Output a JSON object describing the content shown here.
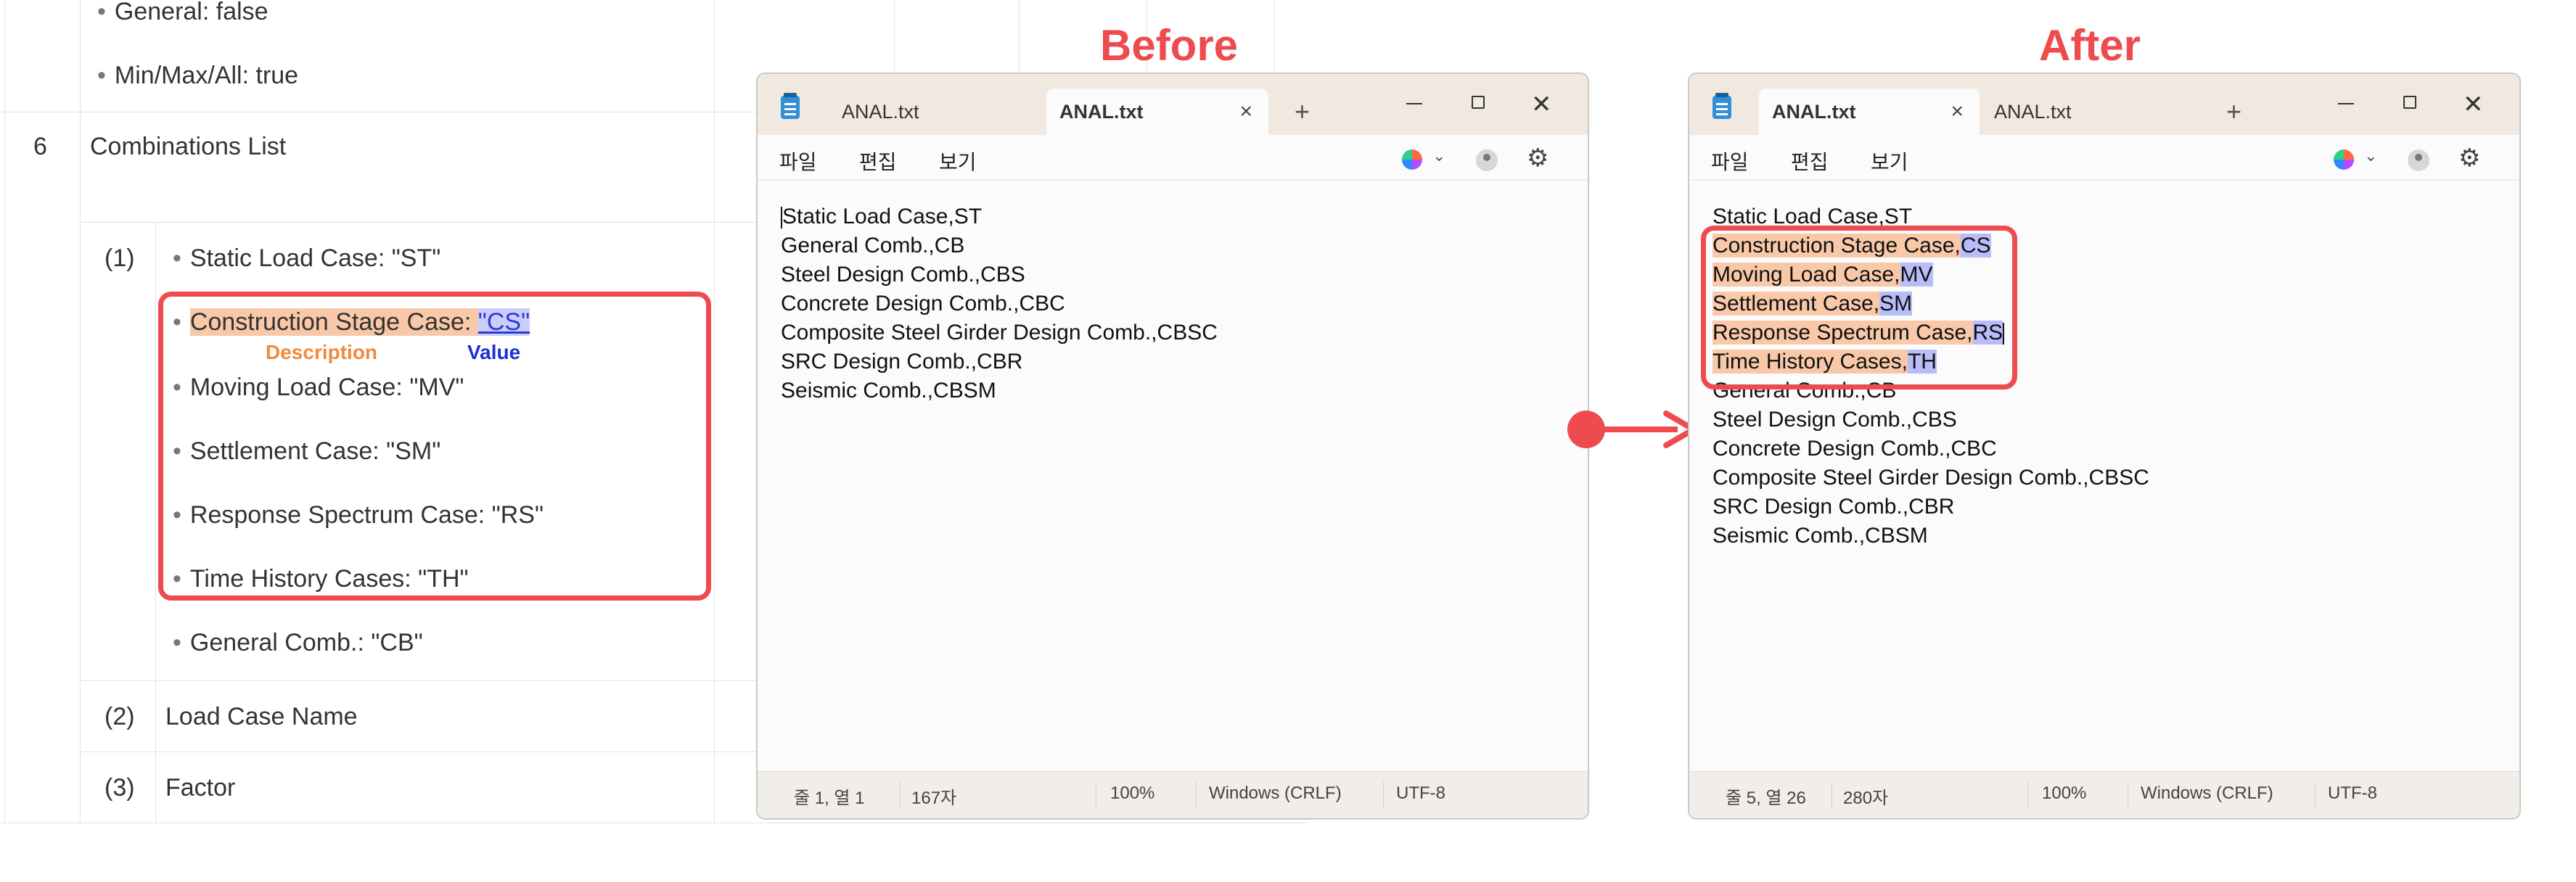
{
  "doc_table": {
    "top_items": [
      "General: false",
      "Min/Max/All: true"
    ],
    "row_no": "6",
    "row_title": "Combinations List",
    "sub1_no": "(1)",
    "items": [
      {
        "desc": "Static Load Case: ",
        "val": "\"ST\""
      },
      {
        "desc": "Construction Stage Case: ",
        "val": "\"CS\""
      },
      {
        "desc": "Moving Load Case: ",
        "val": "\"MV\""
      },
      {
        "desc": "Settlement Case: ",
        "val": "\"SM\""
      },
      {
        "desc": "Response Spectrum Case: ",
        "val": "\"RS\""
      },
      {
        "desc": "Time History Cases: ",
        "val": "\"TH\""
      },
      {
        "desc": "General Comb.: ",
        "val": "\"CB\""
      }
    ],
    "desc_label": "Description",
    "value_label": "Value",
    "sub2_no": "(2)",
    "sub2_title": "Load Case Name",
    "sub3_no": "(3)",
    "sub3_title": "Factor",
    "colors": {
      "accent_red": "#ee4b4f",
      "desc_orange": "#f28a3c",
      "value_blue": "#1b2fd6"
    }
  },
  "headings": {
    "before": "Before",
    "after": "After"
  },
  "before_window": {
    "tabs": [
      {
        "label": "ANAL.txt"
      },
      {
        "label": "ANAL.txt"
      }
    ],
    "menu": [
      "파일",
      "편집",
      "보기"
    ],
    "lines": [
      "Static Load Case,ST",
      "General Comb.,CB",
      "Steel Design Comb.,CBS",
      "Concrete Design Comb.,CBC",
      "Composite Steel Girder Design Comb.,CBSC",
      "SRC Design Comb.,CBR",
      "Seismic Comb.,CBSM"
    ],
    "status": {
      "pos": "줄 1, 열 1",
      "chars": "167자",
      "zoom": "100%",
      "eol": "Windows (CRLF)",
      "enc": "UTF-8"
    }
  },
  "after_window": {
    "tabs": [
      {
        "label": "ANAL.txt"
      },
      {
        "label": "ANAL.txt"
      }
    ],
    "menu": [
      "파일",
      "편집",
      "보기"
    ],
    "line_first": "Static Load Case,ST",
    "new_lines": [
      {
        "desc": "Construction Stage Case,",
        "val": "CS"
      },
      {
        "desc": "Moving Load Case,",
        "val": "MV"
      },
      {
        "desc": "Settlement Case,",
        "val": "SM"
      },
      {
        "desc": "Response Spectrum Case,",
        "val": "RS"
      },
      {
        "desc": "Time History Cases,",
        "val": "TH"
      }
    ],
    "rest_lines": [
      "General Comb.,CB",
      "Steel Design Comb.,CBS",
      "Concrete Design Comb.,CBC",
      "Composite Steel Girder Design Comb.,CBSC",
      "SRC Design Comb.,CBR",
      "Seismic Comb.,CBSM"
    ],
    "status": {
      "pos": "줄 5, 열 26",
      "chars": "280자",
      "zoom": "100%",
      "eol": "Windows (CRLF)",
      "enc": "UTF-8"
    }
  },
  "icons": {
    "tab_close": "×",
    "new_tab": "+",
    "window_close": "✕",
    "chevron": "⌄",
    "gear": "⚙",
    "bullet": "•"
  }
}
